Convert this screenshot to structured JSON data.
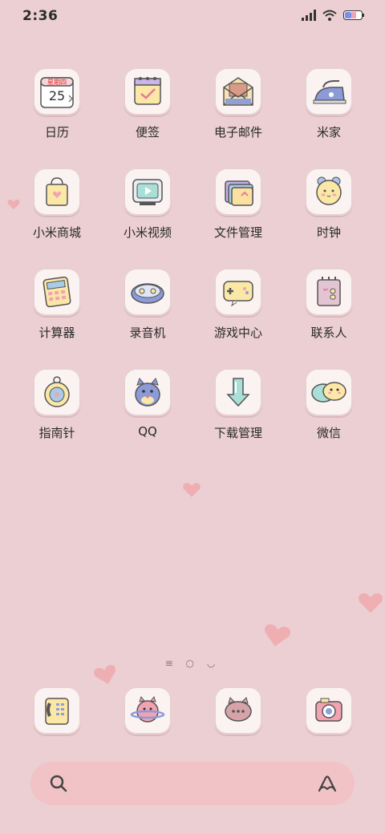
{
  "status": {
    "time": "2:36"
  },
  "apps": [
    {
      "label": "日历",
      "icon": "calendar-icon",
      "badge": "星期四",
      "day": "25"
    },
    {
      "label": "便签",
      "icon": "notes-icon"
    },
    {
      "label": "电子邮件",
      "icon": "email-icon"
    },
    {
      "label": "米家",
      "icon": "iron-icon"
    },
    {
      "label": "小米商城",
      "icon": "shopping-bag-icon"
    },
    {
      "label": "小米视频",
      "icon": "tv-icon"
    },
    {
      "label": "文件管理",
      "icon": "folder-icon"
    },
    {
      "label": "时钟",
      "icon": "alarm-clock-icon"
    },
    {
      "label": "计算器",
      "icon": "calculator-icon"
    },
    {
      "label": "录音机",
      "icon": "tape-recorder-icon"
    },
    {
      "label": "游戏中心",
      "icon": "gamepad-icon"
    },
    {
      "label": "联系人",
      "icon": "contacts-icon"
    },
    {
      "label": "指南针",
      "icon": "compass-icon"
    },
    {
      "label": "QQ",
      "icon": "penguin-icon"
    },
    {
      "label": "下载管理",
      "icon": "download-arrow-icon"
    },
    {
      "label": "微信",
      "icon": "chat-bubbles-icon"
    }
  ],
  "page_indicator": "≡ ○ ◡",
  "dock": [
    {
      "icon": "phone-icon"
    },
    {
      "icon": "cat-planet-icon"
    },
    {
      "icon": "cat-message-icon"
    },
    {
      "icon": "camera-icon"
    }
  ],
  "colors": {
    "background": "#ebcfd2",
    "tile": "#fbf3f2",
    "search": "#f1c3c6",
    "heart": "#efaeb2"
  }
}
